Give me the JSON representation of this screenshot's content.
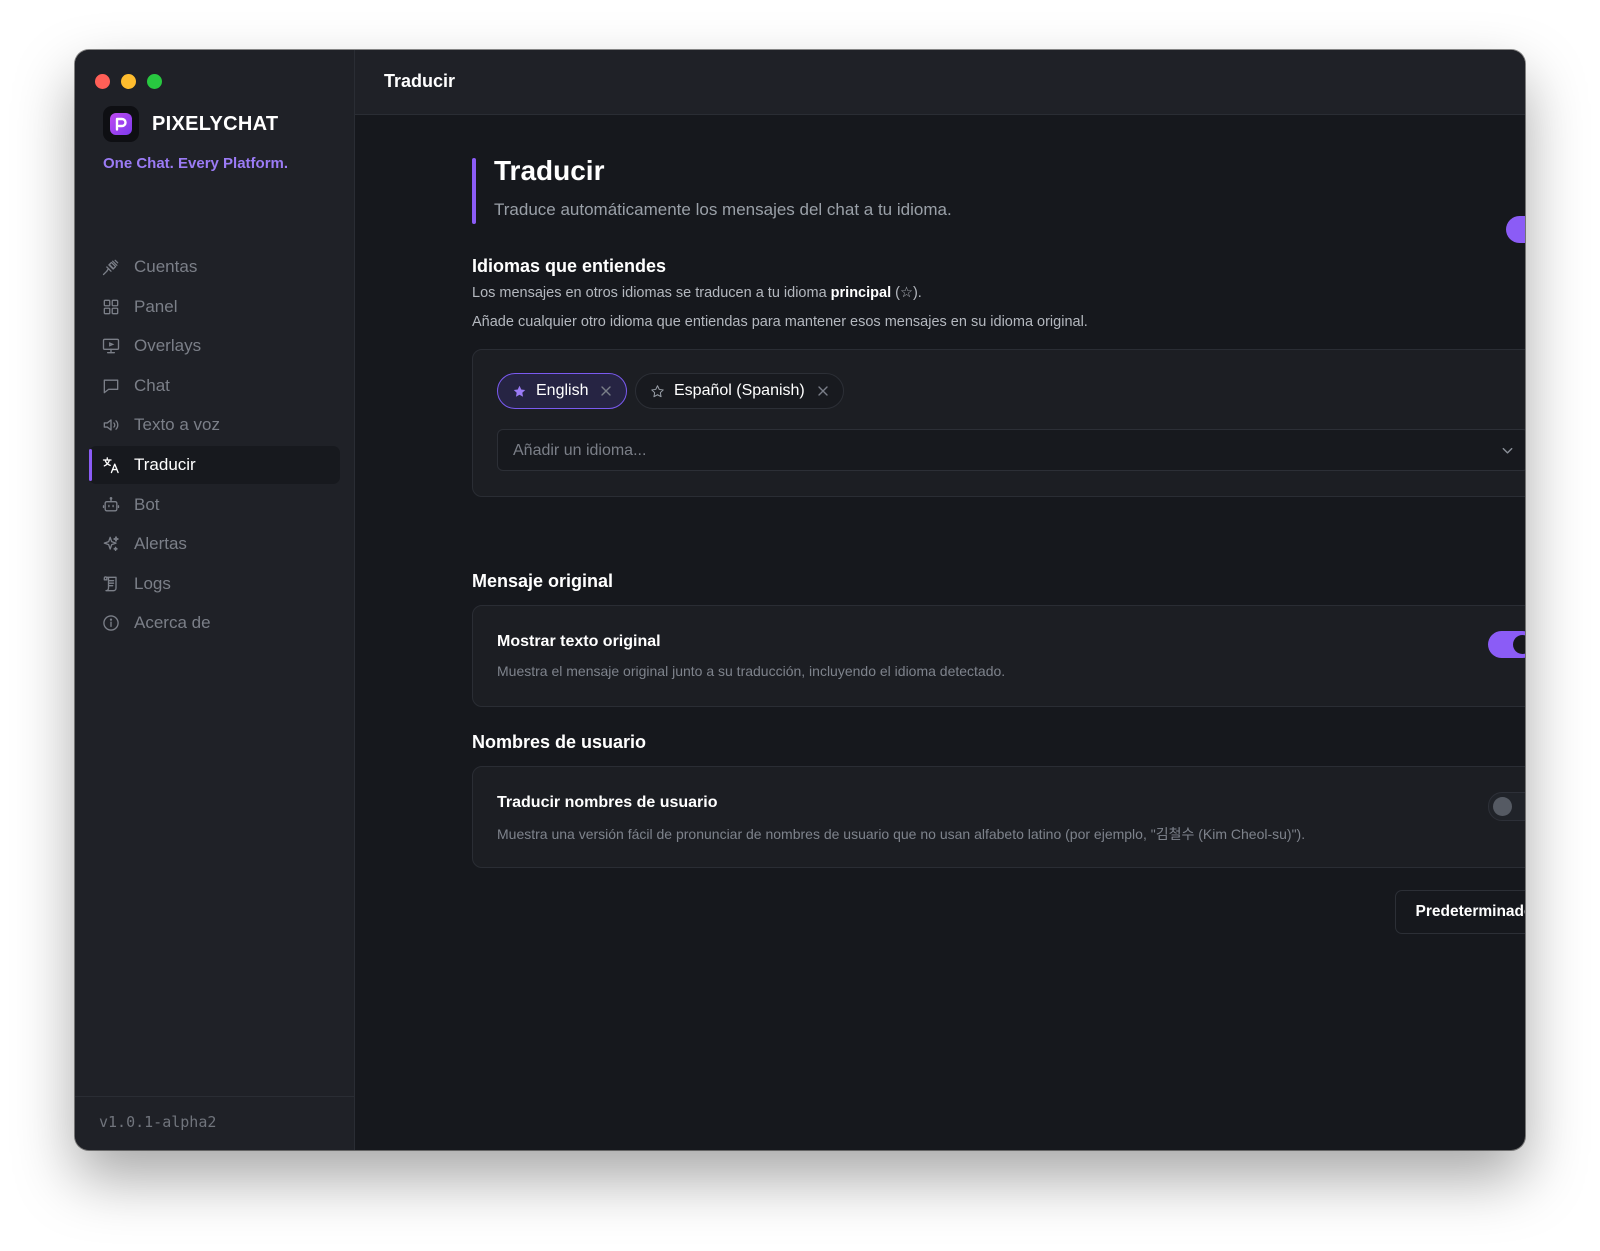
{
  "app": {
    "name": "PIXELYCHAT",
    "tagline": "One Chat. Every Platform.",
    "version": "v1.0.1-alpha2",
    "accent_color": "#8b5cf6"
  },
  "window_controls": [
    "close",
    "minimize",
    "maximize"
  ],
  "sidebar": {
    "items": [
      {
        "label": "Cuentas",
        "icon": "plug-icon",
        "active": false
      },
      {
        "label": "Panel",
        "icon": "dashboard-icon",
        "active": false
      },
      {
        "label": "Overlays",
        "icon": "monitor-icon",
        "active": false
      },
      {
        "label": "Chat",
        "icon": "chat-icon",
        "active": false
      },
      {
        "label": "Texto a voz",
        "icon": "speaker-icon",
        "active": false
      },
      {
        "label": "Traducir",
        "icon": "translate-icon",
        "active": true
      },
      {
        "label": "Bot",
        "icon": "bot-icon",
        "active": false
      },
      {
        "label": "Alertas",
        "icon": "sparkle-icon",
        "active": false
      },
      {
        "label": "Logs",
        "icon": "scroll-icon",
        "active": false
      },
      {
        "label": "Acerca de",
        "icon": "info-icon",
        "active": false
      }
    ]
  },
  "header": {
    "title": "Traducir"
  },
  "main": {
    "title": "Traducir",
    "description": "Traduce automáticamente los mensajes del chat a tu idioma.",
    "enabled": true,
    "languages": {
      "title": "Idiomas que entiendes",
      "text1_prefix": "Los mensajes en otros idiomas se traducen a tu idioma ",
      "text1_bold": "principal",
      "text1_suffix": " (☆).",
      "text2": "Añade cualquier otro idioma que entiendas para mantener esos mensajes en su idioma original.",
      "chips": [
        {
          "label": "English",
          "primary": true
        },
        {
          "label": "Español (Spanish)",
          "primary": false
        }
      ],
      "add_placeholder": "Añadir un idioma..."
    },
    "original": {
      "section_title": "Mensaje original",
      "card_title": "Mostrar texto original",
      "card_desc": "Muestra el mensaje original junto a su traducción, incluyendo el idioma detectado.",
      "enabled": true
    },
    "usernames": {
      "section_title": "Nombres de usuario",
      "card_title": "Traducir nombres de usuario",
      "card_desc": "Muestra una versión fácil de pronunciar de nombres de usuario que no usan alfabeto latino (por ejemplo, \"김철수 (Kim Cheol-su)\").",
      "enabled": false
    },
    "default_button": "Predeterminado"
  }
}
